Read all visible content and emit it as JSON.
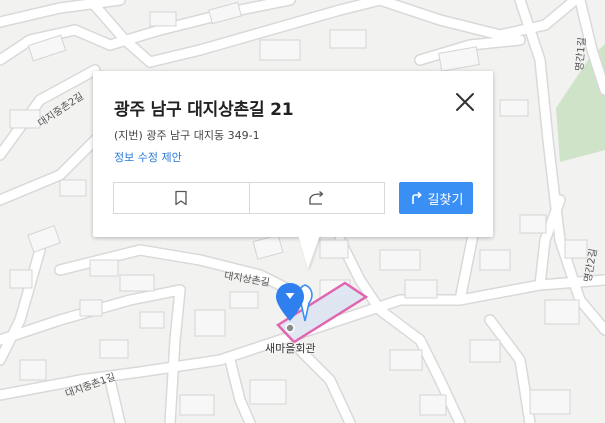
{
  "popup": {
    "title": "광주 남구 대지상촌길 21",
    "jibun": "(지번) 광주 남구 대지동 349-1",
    "edit_link": "정보 수정 제안",
    "save_icon": "bookmark-icon",
    "share_icon": "share-icon",
    "close_icon": "close-icon",
    "route_icon": "route-arrow-icon",
    "route_label": "길찾기"
  },
  "map": {
    "road_labels": {
      "daeji_sangchon": "대지상촌길",
      "daeji_jungchon2": "대지중촌2길",
      "daeji_jungchon1": "대지중촌1길",
      "myeonggan1": "명간1길",
      "myeonggan2": "명간2길"
    },
    "poi_label": "새마을회관",
    "colors": {
      "background": "#f2f2f0",
      "road": "#ffffff",
      "road_casing": "#d9d9d9",
      "building": "#f7f7f7",
      "park": "#cfe3c8",
      "highlight": "#e066b0",
      "accent": "#3a8ff5"
    }
  }
}
